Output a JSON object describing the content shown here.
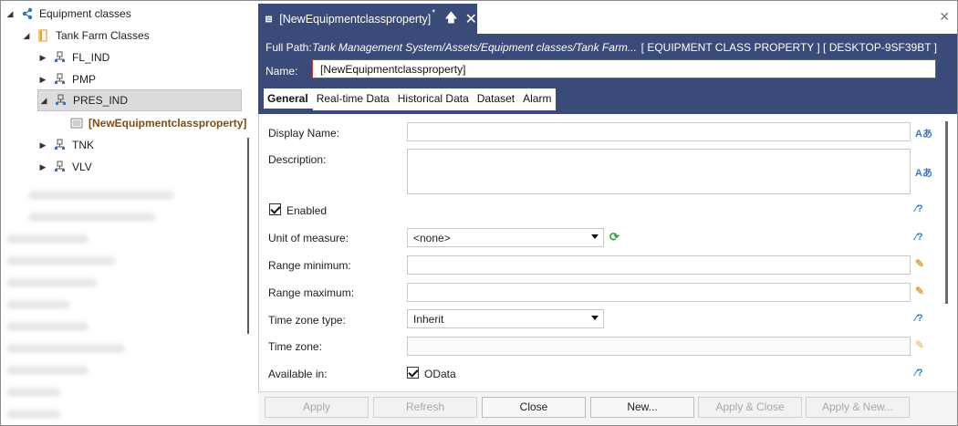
{
  "tree": {
    "root": {
      "label": "Equipment classes"
    },
    "folder": {
      "label": "Tank Farm Classes"
    },
    "items": [
      {
        "label": "FL_IND"
      },
      {
        "label": "PMP"
      },
      {
        "label": "PRES_IND"
      },
      {
        "label": "[NewEquipmentclassproperty]"
      },
      {
        "label": "TNK"
      },
      {
        "label": "VLV"
      }
    ]
  },
  "doc_tab": {
    "title": "[NewEquipmentclassproperty]",
    "modified_mark": "*"
  },
  "header": {
    "full_path_label": "Full Path:",
    "full_path_value": "Tank Management System/Assets/Equipment classes/Tank Farm...",
    "right_info": "[ EQUIPMENT CLASS PROPERTY ] [ DESKTOP-9SF39BT ]",
    "name_label": "Name:",
    "name_value": "[NewEquipmentclassproperty]"
  },
  "tabs": [
    "General",
    "Real-time Data",
    "Historical Data",
    "Dataset",
    "Alarm"
  ],
  "form": {
    "display_name_label": "Display Name:",
    "description_label": "Description:",
    "enabled_label": "Enabled",
    "unit_label": "Unit of measure:",
    "unit_value": "<none>",
    "range_min_label": "Range minimum:",
    "range_max_label": "Range maximum:",
    "tz_type_label": "Time zone type:",
    "tz_type_value": "Inherit",
    "tz_label": "Time zone:",
    "available_label": "Available in:",
    "odata_label": "OData",
    "lang_icon": "Aあ"
  },
  "buttons": {
    "apply": "Apply",
    "refresh": "Refresh",
    "close": "Close",
    "new": "New...",
    "apply_close": "Apply & Close",
    "apply_new": "Apply & New..."
  },
  "colors": {
    "header_bg": "#3a4b7a",
    "name_border": "#d23b2b",
    "link_icon": "#3b77c7",
    "ruler_icon": "#e4a33c"
  }
}
